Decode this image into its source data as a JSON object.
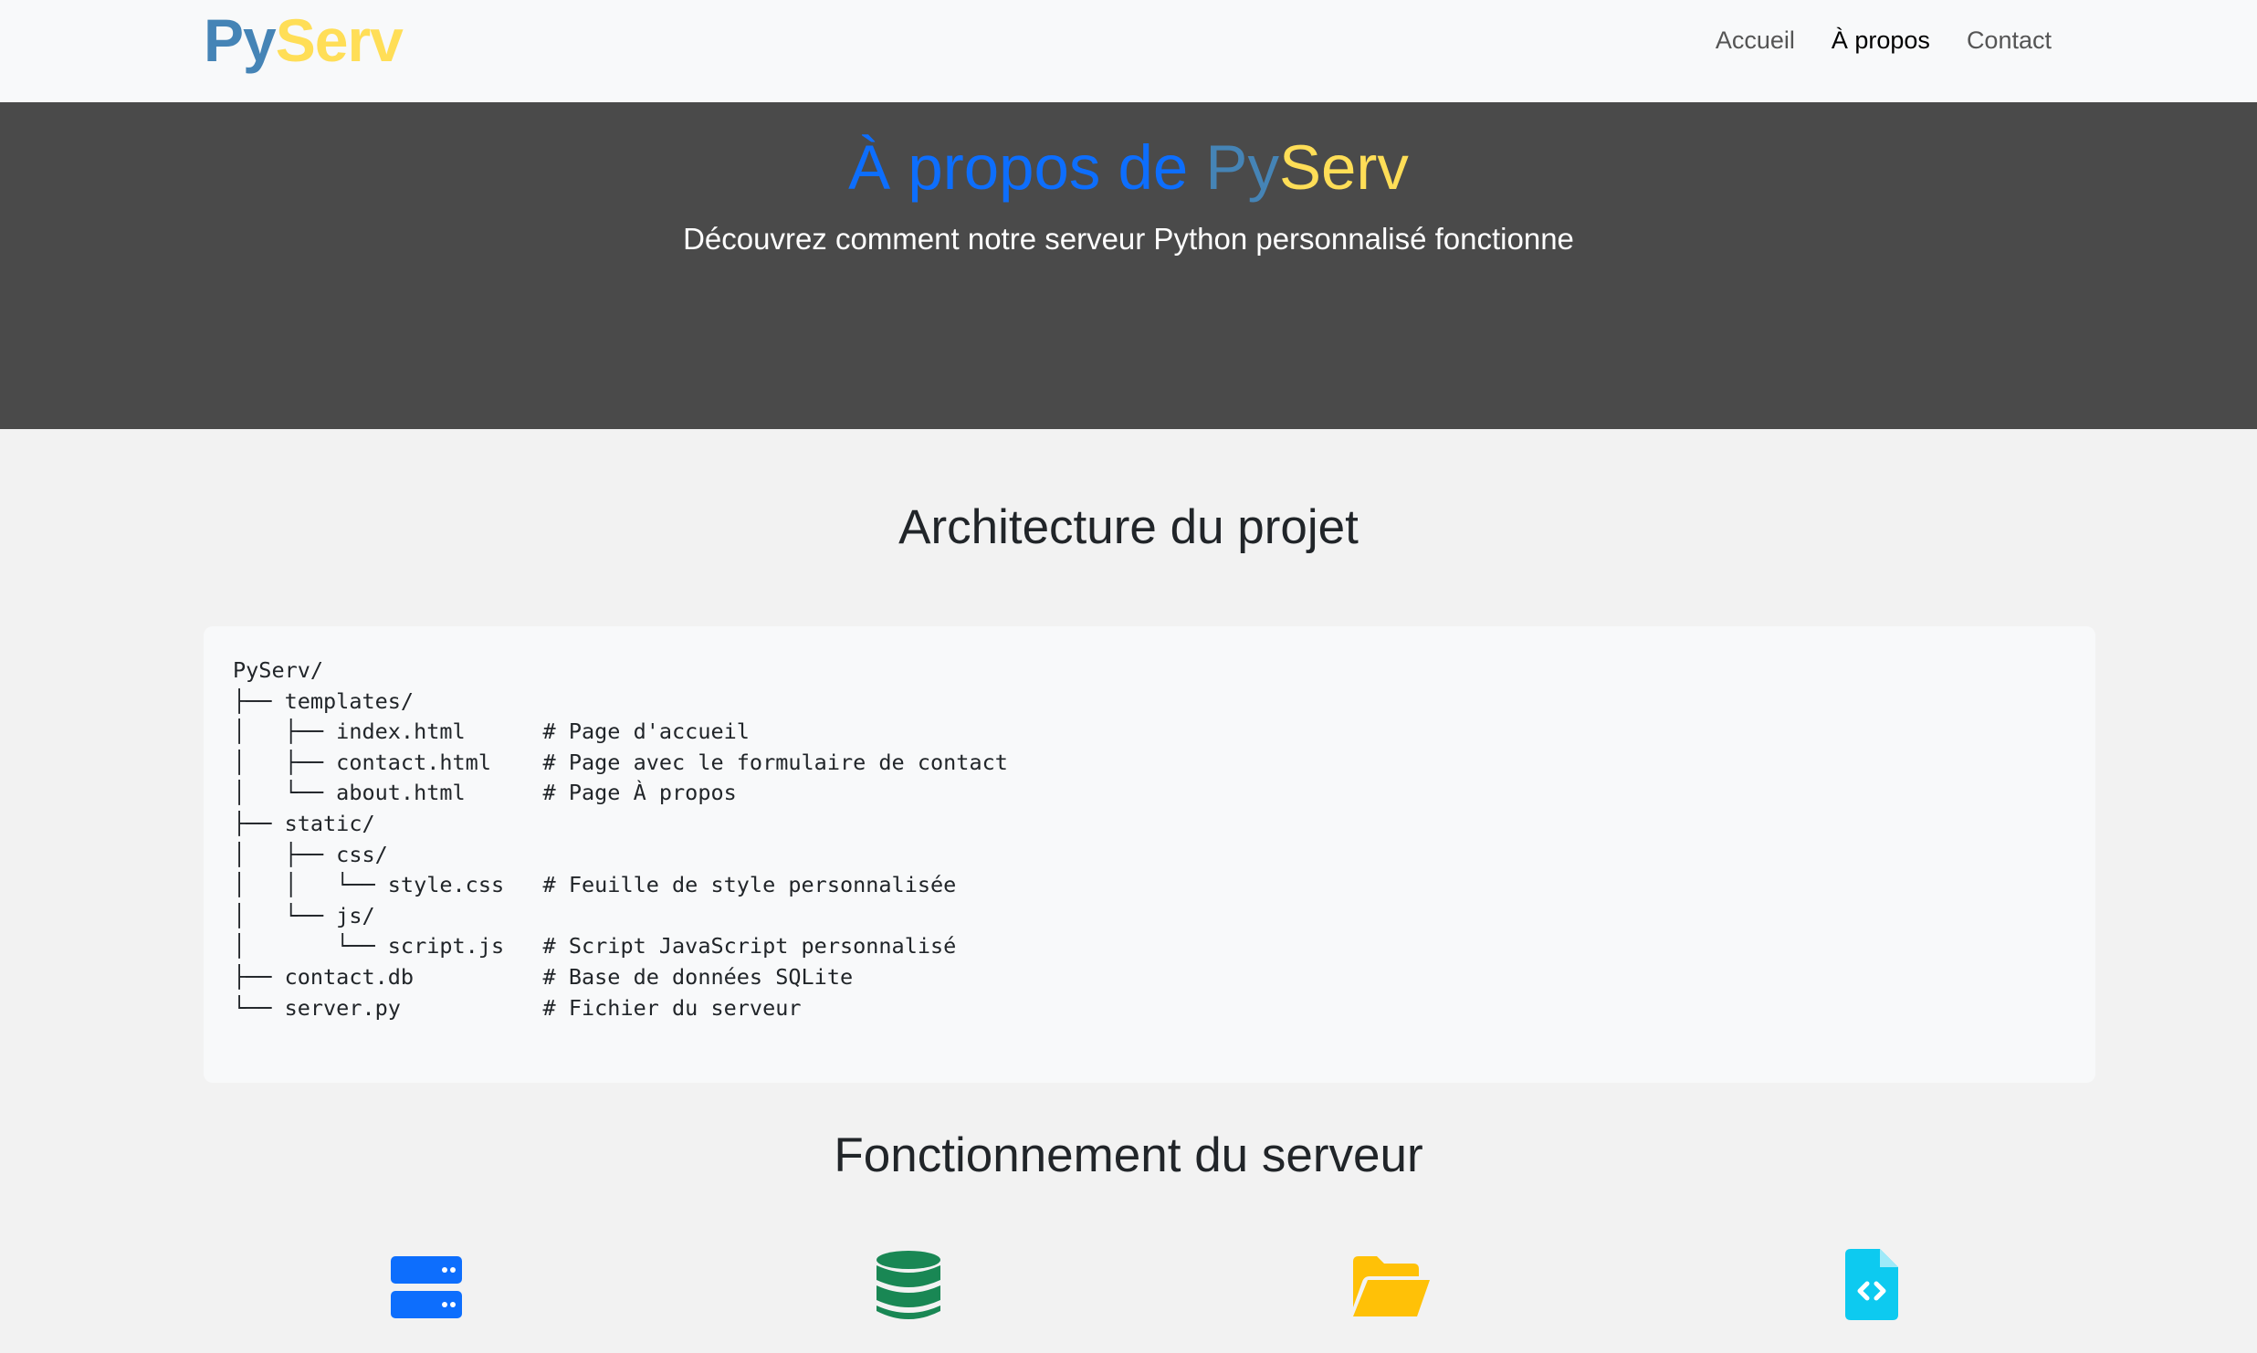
{
  "navbar": {
    "brand_py": "Py",
    "brand_serv": "Serv",
    "links": [
      {
        "label": "Accueil"
      },
      {
        "label": "À propos"
      },
      {
        "label": "Contact"
      }
    ]
  },
  "hero": {
    "title_prefix": "À propos de ",
    "title_py": "Py",
    "title_serv": "Serv",
    "subtitle": "Découvrez comment notre serveur Python personnalisé fonctionne"
  },
  "architecture": {
    "title": "Architecture du projet",
    "tree": "PyServ/\n├── templates/\n│   ├── index.html      # Page d'accueil\n│   ├── contact.html    # Page avec le formulaire de contact\n│   └── about.html      # Page À propos\n├── static/\n│   ├── css/\n│   │   └── style.css   # Feuille de style personnalisée\n│   └── js/\n│       └── script.js   # Script JavaScript personnalisé\n├── contact.db          # Base de données SQLite\n└── server.py           # Fichier du serveur"
  },
  "operation": {
    "title": "Fonctionnement du serveur",
    "icons": [
      {
        "name": "server-icon",
        "color": "#0d6efd"
      },
      {
        "name": "database-icon",
        "color": "#198754"
      },
      {
        "name": "folder-open-icon",
        "color": "#ffc107"
      },
      {
        "name": "file-code-icon",
        "color": "#0dcaf0"
      }
    ]
  }
}
